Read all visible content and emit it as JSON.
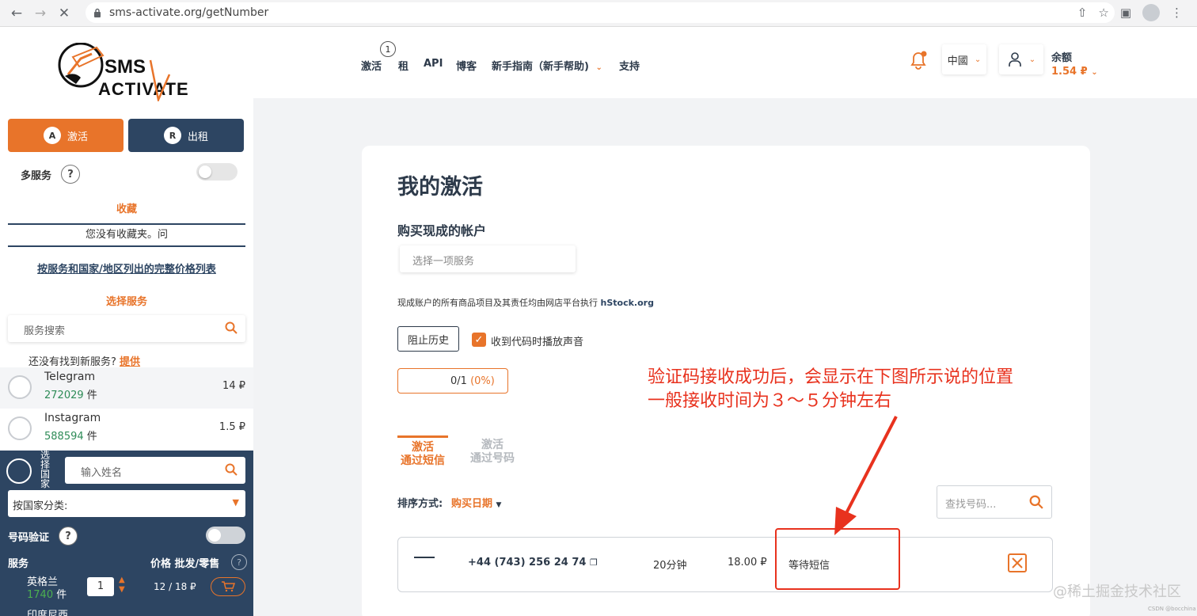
{
  "browser": {
    "url": "sms-activate.org/getNumber"
  },
  "sidebar": {
    "activate_label": "激活",
    "rent_label": "出租",
    "multi_service_label": "多服务",
    "favorites_title": "收藏",
    "favorites_empty": "您没有收藏夹。问",
    "price_list_link": "按服务和国家/地区列出的完整价格列表",
    "select_service_title": "选择服务",
    "service_search_placeholder": "服务搜索",
    "not_found_text": "还没有找到新服务?",
    "not_found_link": "提供",
    "services": [
      {
        "name": "Telegram",
        "count": "272029",
        "unit": "件",
        "price": "14 ₽"
      },
      {
        "name": "Instagram",
        "count": "588594",
        "unit": "件",
        "price": "1.5 ₽"
      }
    ],
    "country_vertical": "选择国家",
    "name_input_placeholder": "输入姓名",
    "country_sort_label": "按国家分类:",
    "number_verify_label": "号码验证",
    "service_header": "服务",
    "price_header": "价格 批发/零售",
    "country": {
      "name": "英格兰",
      "count": "1740",
      "unit": "件",
      "qty": "1",
      "price": "12 / 18 ₽"
    },
    "next_country": "印度尼西"
  },
  "topnav": {
    "items": [
      "激活",
      "租",
      "API",
      "博客",
      "新手指南（新手帮助)",
      "支持"
    ],
    "rent_badge": "1",
    "lang": "中國",
    "balance_label": "余额",
    "balance_value": "1.54 ₽"
  },
  "card": {
    "title": "我的激活",
    "buy_title": "购买现成的帐户",
    "service_placeholder": "选择一项服务",
    "note_prefix": "现成账户的所有商品项目及其责任均由网店平台执行",
    "note_link": "hStock.org",
    "block_history": "阻止历史",
    "sound_label": "收到代码时播放声音",
    "progress_count": "0/1",
    "progress_pct": "(0%)",
    "tab_sms_1": "激活",
    "tab_sms_2": "通过短信",
    "tab_num_1": "激活",
    "tab_num_2": "通过号码",
    "sort_label": "排序方式:",
    "sort_value": "购买日期",
    "find_placeholder": "查找号码...",
    "row": {
      "phone": "+44 (743) 256 24 74",
      "time": "20分钟",
      "price": "18.00 ₽",
      "status": "等待短信"
    }
  },
  "annotation": {
    "line1": "验证码接收成功后，会显示在下图所示说的位置",
    "line2": "一般接收时间为３～５分钟左右"
  },
  "watermark": "@稀土掘金技术社区",
  "watermark_small": "CSDN @bocchina",
  "colors": {
    "accent": "#e8742a",
    "navy": "#2d4562",
    "annotation": "#e8321e"
  }
}
